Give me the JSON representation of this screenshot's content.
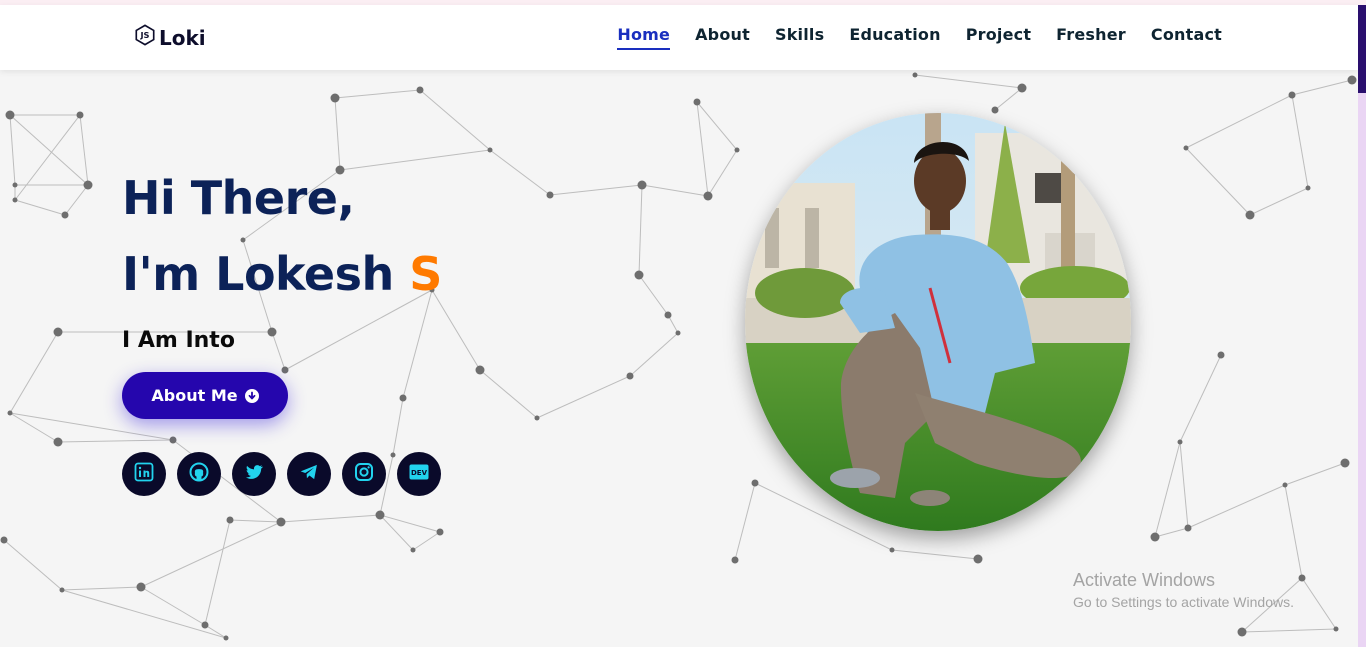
{
  "brand": {
    "name": "Loki",
    "logo_icon": "js-hexagon-icon"
  },
  "nav": {
    "items": [
      {
        "label": "Home",
        "active": true
      },
      {
        "label": "About",
        "active": false
      },
      {
        "label": "Skills",
        "active": false
      },
      {
        "label": "Education",
        "active": false
      },
      {
        "label": "Project",
        "active": false
      },
      {
        "label": "Fresher",
        "active": false
      },
      {
        "label": "Contact",
        "active": false
      }
    ]
  },
  "hero": {
    "greeting": "Hi There,",
    "intro_prefix": "I'm Lokesh",
    "intro_accent": "S",
    "tagline": "I Am Into",
    "button_label": "About Me",
    "button_icon": "arrow-down-circle-icon",
    "socials": [
      {
        "name": "linkedin",
        "icon": "linkedin-icon"
      },
      {
        "name": "github",
        "icon": "github-icon"
      },
      {
        "name": "twitter",
        "icon": "twitter-icon"
      },
      {
        "name": "telegram",
        "icon": "telegram-icon"
      },
      {
        "name": "instagram",
        "icon": "instagram-icon"
      },
      {
        "name": "dev",
        "icon": "dev-icon",
        "text": "DEV"
      }
    ],
    "profile_image": "portrait-photo"
  },
  "os_watermark": {
    "title": "Activate Windows",
    "subtitle": "Go to Settings to activate Windows."
  },
  "colors": {
    "heading": "#0c2258",
    "accent": "#ff7a00",
    "primary": "#2506ad",
    "nav_active": "#1a2fbf",
    "social_bg": "#0a0a2a",
    "social_icon": "#22d3ee",
    "background": "#f5f5f5"
  }
}
